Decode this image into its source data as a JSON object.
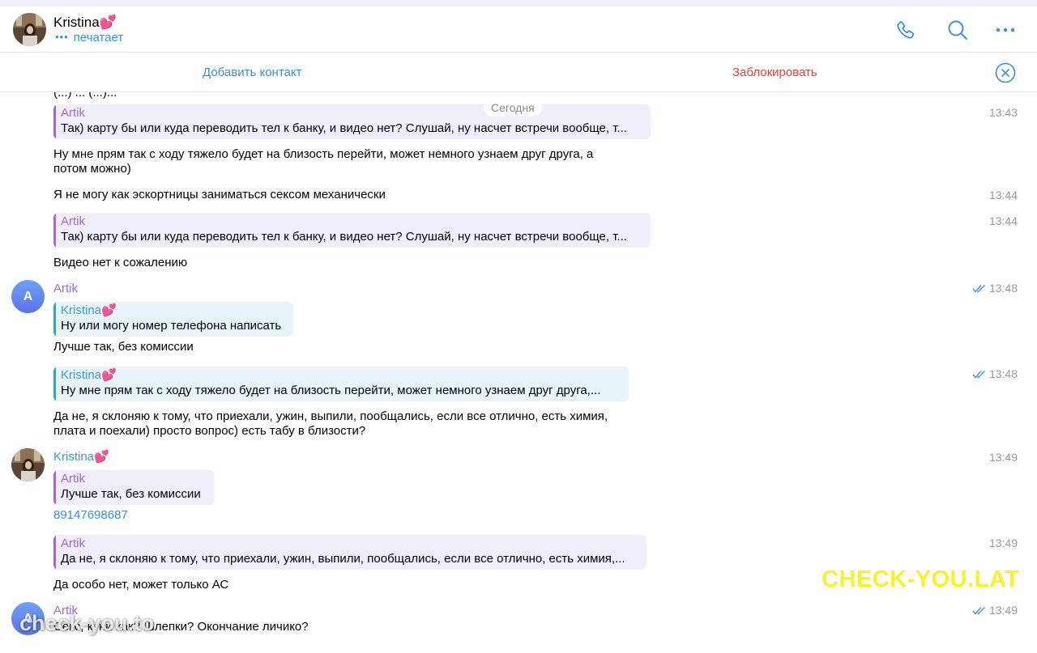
{
  "header": {
    "contact_name": "Kristina💕",
    "status_dots": "•••",
    "status": "печатает"
  },
  "action_bar": {
    "add_contact": "Добавить контакт",
    "block": "Заблокировать"
  },
  "chat": {
    "cutoff_text": "(...) ... (...)...",
    "date_label": "Сегодня",
    "items": [
      {
        "reply_name": "Artik",
        "reply_text": "Так) карту бы или куда переводить тел к банку, и видео нет? Слушай, ну насчет встречи вообще, т...",
        "time": "13:43"
      },
      {
        "text_line1": "Ну мне прям так с ходу тяжело будет на близость перейти, может немного узнаем друг друга, а",
        "text_line2": "потом можно)"
      },
      {
        "text": "Я не могу как эскортницы заниматься сексом механически",
        "time": "13:44"
      },
      {
        "reply_name": "Artik",
        "reply_text": "Так) карту бы или куда переводить тел к банку, и видео нет? Слушай, ну насчет встречи вообще, т...",
        "time": "13:44"
      },
      {
        "text": "Видео нет к сожалению"
      },
      {
        "avatar_letter": "A",
        "sender": "Artik",
        "time": "13:48",
        "reply_name": "Kristina💕",
        "reply_text": "Ну или могу номер телефона написать",
        "text": "Лучше так, без комиссии"
      },
      {
        "reply_name": "Kristina💕",
        "reply_text": "Ну мне прям так с ходу тяжело будет на близость перейти, может немного узнаем друг друга,...",
        "time": "13:48",
        "text_line1": "Да не, я склоняю к тому, что приехали, ужин, выпили, пообщались, если все отлично, есть химия,",
        "text_line2": "плата и поехали) просто вопрос) есть табу в близости?"
      },
      {
        "sender": "Kristina💕",
        "time": "13:49",
        "reply_name": "Artik",
        "reply_text": "Лучше так, без комиссии",
        "text": "89147698687"
      },
      {
        "reply_name": "Artik",
        "reply_text": "Да не, я склоняю к тому, что приехали, ужин, выпили, пообщались, если все отлично, есть химия,...",
        "time": "13:49",
        "text": "Да особо нет, может только АС"
      },
      {
        "avatar_letter": "A",
        "sender": "Artik",
        "time": "13:49",
        "text": "Секс, куни как? Шлепки? Окончание личико?"
      }
    ]
  },
  "watermarks": {
    "right": "CHECK-YOU.LAT",
    "left": "check-you.to"
  },
  "colors": {
    "accent": "#3d8fd5",
    "danger": "#e0443c",
    "artik_name": "#9c6bd6",
    "kristina_name": "#3d9bcf",
    "watermark": "#f8f227"
  }
}
